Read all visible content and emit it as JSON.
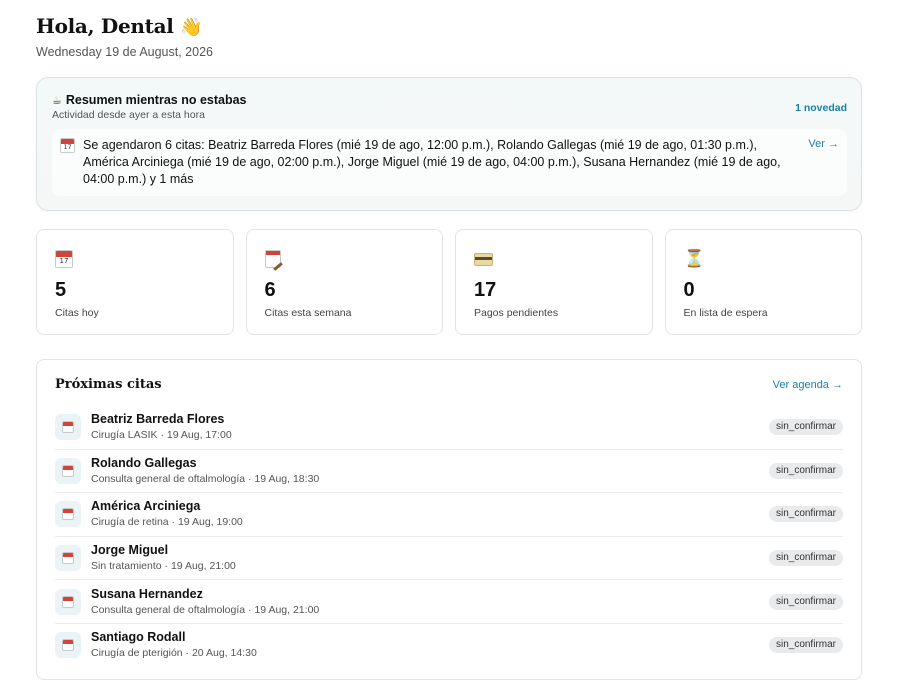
{
  "header": {
    "greeting": "Hola, Dental",
    "wave_icon": "waving-hand-icon",
    "date": "Wednesday 19 de August, 2026"
  },
  "summary": {
    "icon": "coffee-icon",
    "title": "Resumen mientras no estabas",
    "subtitle": "Actividad desde ayer a esta hora",
    "badge": "1 novedad",
    "item": {
      "icon": "calendar-icon",
      "icon_number": "17",
      "text": "Se agendaron 6 citas: Beatriz Barreda Flores (mié 19 de ago, 12:00 p.m.), Rolando Gallegas (mié 19 de ago, 01:30 p.m.), América Arciniega (mié 19 de ago, 02:00 p.m.), Jorge Miguel (mié 19 de ago, 04:00 p.m.), Susana Hernandez (mié 19 de ago, 04:00 p.m.) y 1 más",
      "link": "Ver →"
    }
  },
  "stats": [
    {
      "icon": "calendar-icon",
      "icon_number": "17",
      "value": "5",
      "label": "Citas hoy"
    },
    {
      "icon": "notepad-pencil-icon",
      "value": "6",
      "label": "Citas esta semana"
    },
    {
      "icon": "credit-card-icon",
      "value": "17",
      "label": "Pagos pendientes"
    },
    {
      "icon": "hourglass-icon",
      "glyph": "⏳",
      "value": "0",
      "label": "En lista de espera"
    }
  ],
  "upcoming": {
    "title": "Próximas citas",
    "link": "Ver agenda →",
    "rows": [
      {
        "name": "Beatriz Barreda Flores",
        "meta": "Cirugía LASIK · 19 Aug, 17:00",
        "status": "sin_confirmar"
      },
      {
        "name": "Rolando Gallegas",
        "meta": "Consulta general de oftalmología · 19 Aug, 18:30",
        "status": "sin_confirmar"
      },
      {
        "name": "América Arciniega",
        "meta": "Cirugía de retina · 19 Aug, 19:00",
        "status": "sin_confirmar"
      },
      {
        "name": "Jorge Miguel",
        "meta": "Sin tratamiento · 19 Aug, 21:00",
        "status": "sin_confirmar"
      },
      {
        "name": "Susana Hernandez",
        "meta": "Consulta general de oftalmología · 19 Aug, 21:00",
        "status": "sin_confirmar"
      },
      {
        "name": "Santiago Rodall",
        "meta": "Cirugía de pterigión · 20 Aug, 14:30",
        "status": "sin_confirmar"
      }
    ]
  },
  "colors": {
    "accent": "#1b7fa6",
    "calendar_red": "#d2433b",
    "status_bg": "#e9eaec"
  }
}
